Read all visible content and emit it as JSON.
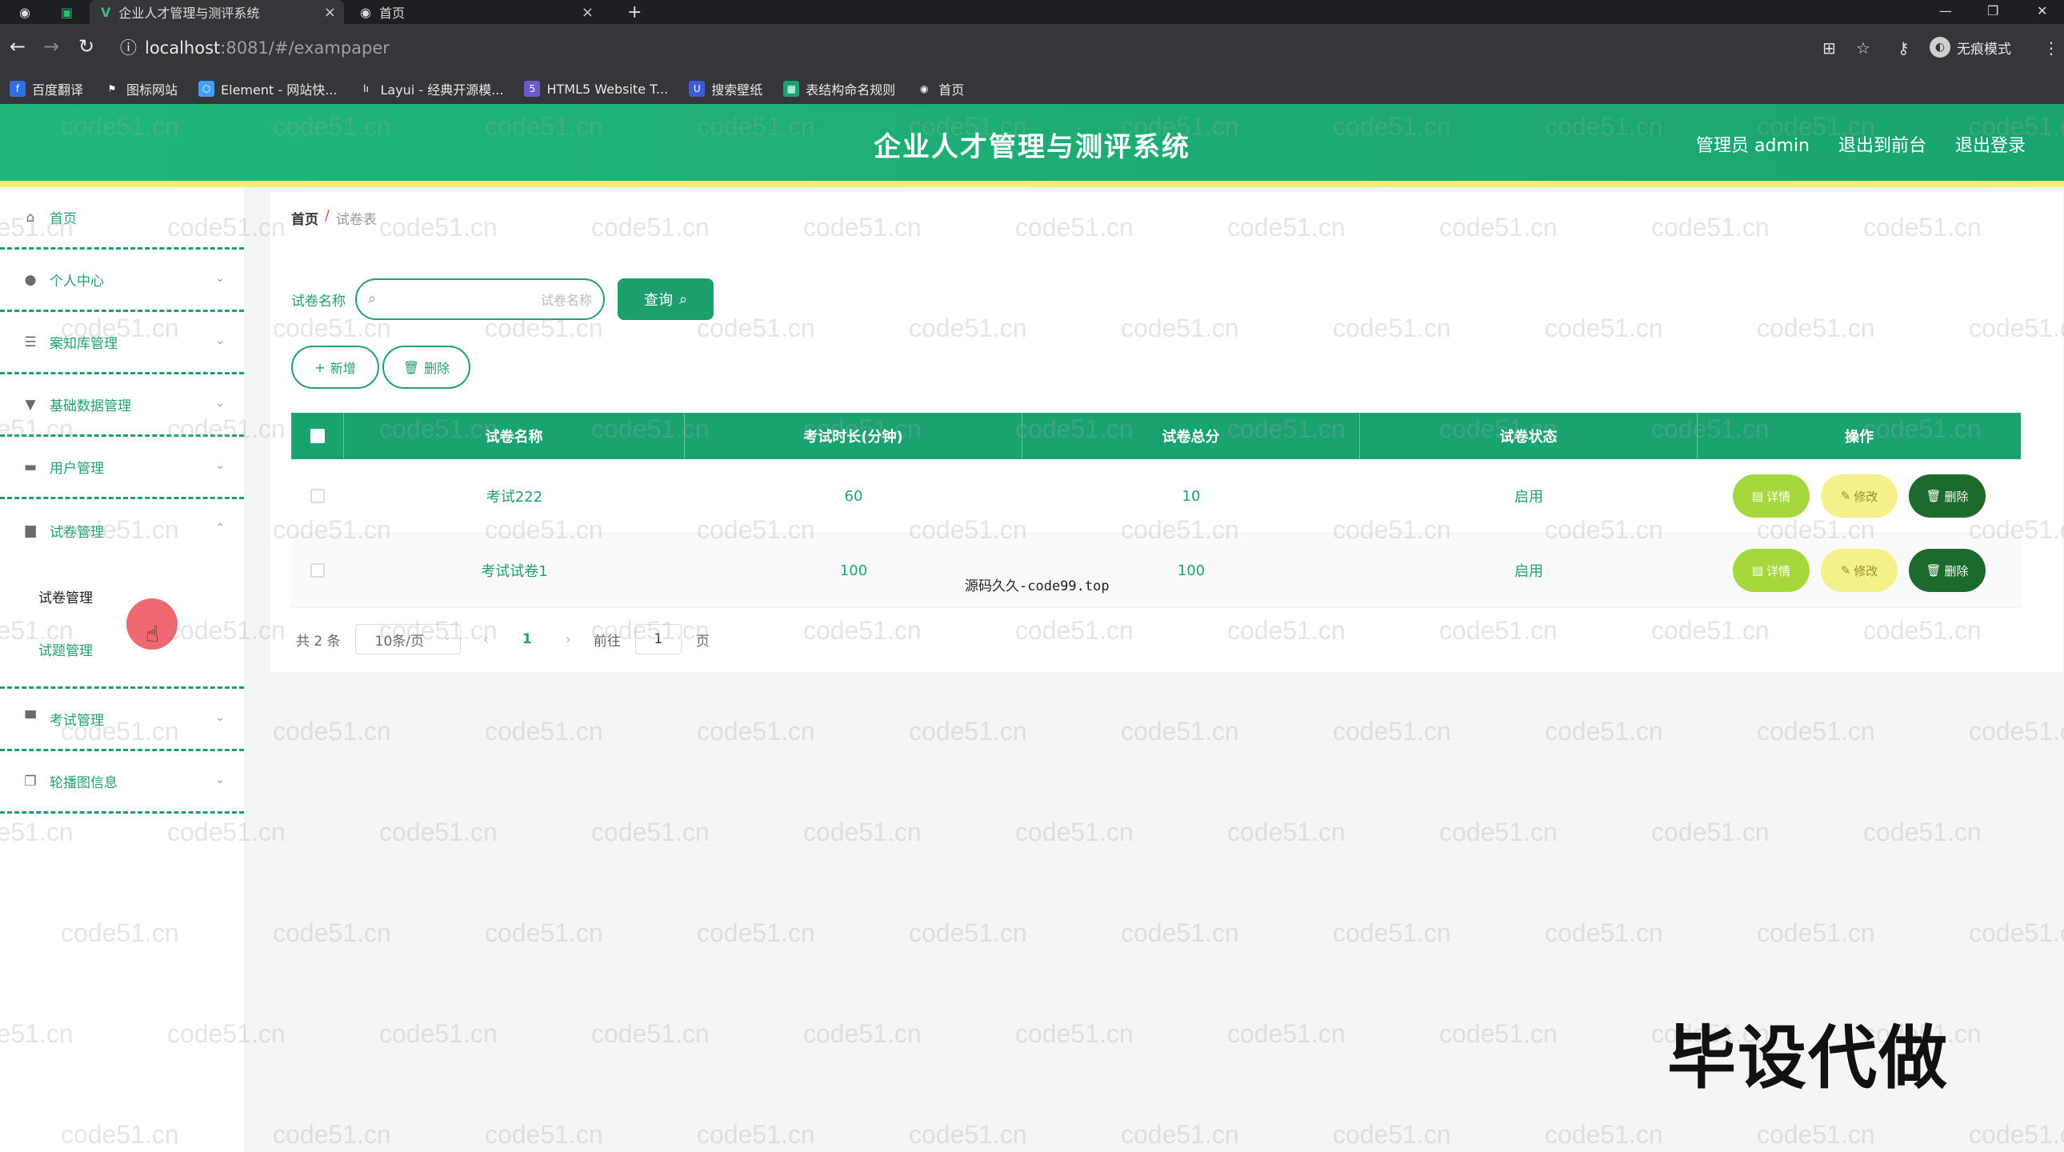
{
  "browser": {
    "tabs": [
      {
        "title": "",
        "icon": "globe-icon"
      },
      {
        "title": "",
        "icon": "green-app-icon"
      },
      {
        "title": "企业人才管理与测评系统",
        "icon": "vue-logo-icon",
        "active": true
      },
      {
        "title": "首页",
        "icon": "globe-icon"
      }
    ],
    "url_host": "localhost",
    "url_path": ":8081/#/exampaper",
    "incognito_label": "无痕模式",
    "bookmarks": [
      {
        "label": "百度翻译",
        "color": "#2f6fe4"
      },
      {
        "label": "图标网站",
        "color": "#555555"
      },
      {
        "label": "Element - 网站快...",
        "color": "#409eff"
      },
      {
        "label": "Layui - 经典开源模...",
        "color": "#555555"
      },
      {
        "label": "HTML5 Website T...",
        "color": "#6a5acd"
      },
      {
        "label": "搜索壁纸",
        "color": "#3b5bdb"
      },
      {
        "label": "表结构命名规则",
        "color": "#1aa46d"
      },
      {
        "label": "首页",
        "color": "#555555"
      }
    ]
  },
  "header": {
    "title": "企业人才管理与测评系统",
    "links": [
      "管理员 admin",
      "退出到前台",
      "退出登录"
    ]
  },
  "sidebar": {
    "items": [
      {
        "label": "首页",
        "icon": "home-icon",
        "chevron": false
      },
      {
        "label": "个人中心",
        "icon": "user-icon",
        "chevron": true
      },
      {
        "label": "案知库管理",
        "icon": "sliders-icon",
        "chevron": true
      },
      {
        "label": "基础数据管理",
        "icon": "trophy-icon",
        "chevron": true
      },
      {
        "label": "用户管理",
        "icon": "monitor-icon",
        "chevron": true
      },
      {
        "label": "试卷管理",
        "icon": "folder-icon",
        "chevron": true,
        "open": true
      },
      {
        "label": "考试管理",
        "icon": "keyboard-icon",
        "chevron": true
      },
      {
        "label": "轮播图信息",
        "icon": "copy-icon",
        "chevron": true
      }
    ],
    "subitems": [
      "试卷管理",
      "试题管理"
    ]
  },
  "breadcrumb": {
    "home": "首页",
    "sep": "/",
    "current": "试卷表"
  },
  "search": {
    "label": "试卷名称",
    "placeholder": "试卷名称",
    "button": "查询"
  },
  "actions": {
    "add": "新增",
    "delete": "删除"
  },
  "table": {
    "headers": [
      "试卷名称",
      "考试时长(分钟)",
      "试卷总分",
      "试卷状态",
      "操作"
    ],
    "rows": [
      {
        "name": "考试222",
        "duration": "60",
        "score": "10",
        "status": "启用"
      },
      {
        "name": "考试试卷1",
        "duration": "100",
        "score": "100",
        "status": "启用"
      }
    ],
    "op_labels": {
      "detail": "详情",
      "edit": "修改",
      "delete": "删除"
    }
  },
  "pager": {
    "total": "共 2 条",
    "size": "10条/页",
    "page": "1",
    "goto": "前往",
    "goto_value": "1",
    "unit": "页"
  },
  "overlay_text": "源码久久-code99.top",
  "stamp": "毕设代做",
  "watermark": "code51.cn",
  "colors": {
    "primary": "#1aa46d",
    "accent_yellow": "#eef07a",
    "danger_dark": "#1d6b2c"
  }
}
